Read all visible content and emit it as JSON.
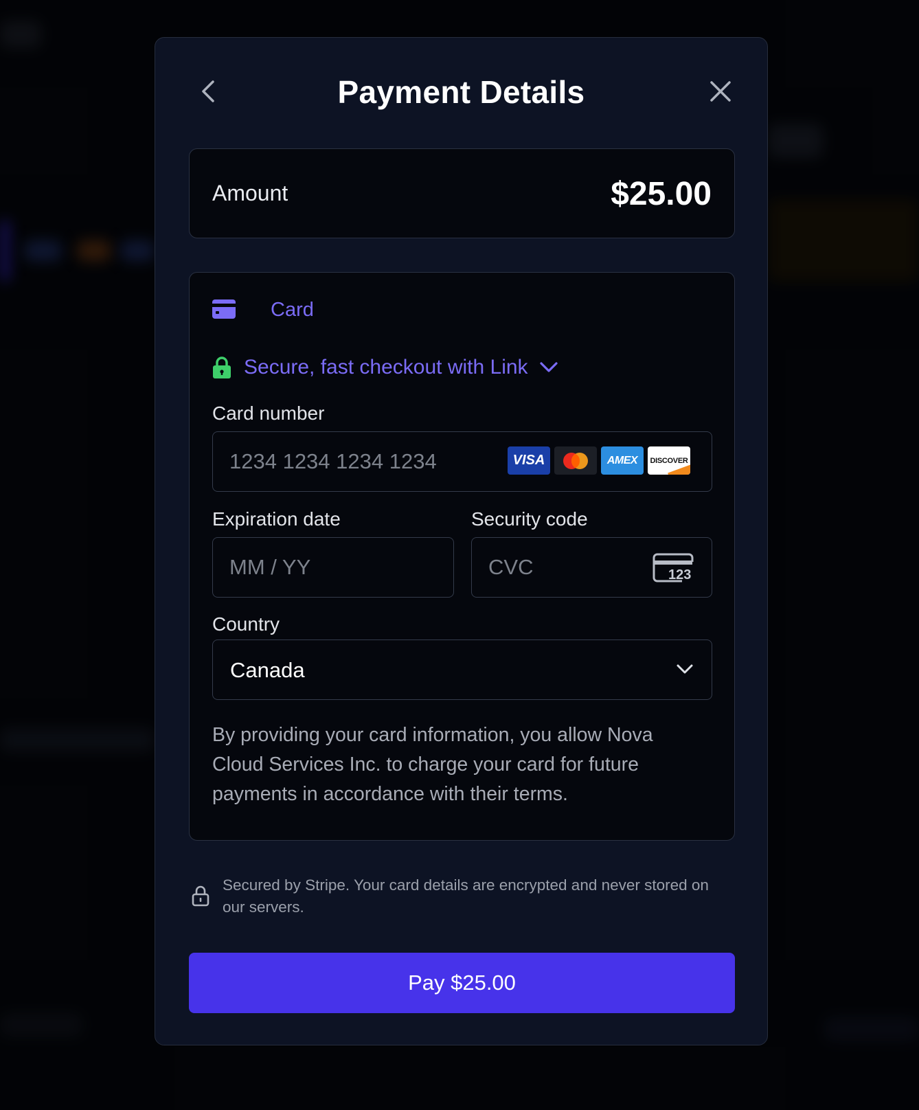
{
  "modal": {
    "title": "Payment Details",
    "back_icon": "chevron-left-icon",
    "close_icon": "close-icon"
  },
  "amount": {
    "label": "Amount",
    "value": "$25.00"
  },
  "payment_method": {
    "tab_label": "Card",
    "tab_icon": "credit-card-icon",
    "link_text": "Secure, fast checkout with Link",
    "link_icon": "lock-icon"
  },
  "card_number": {
    "label": "Card number",
    "placeholder": "1234 1234 1234 1234",
    "brands": [
      "VISA",
      "mastercard",
      "AMEX",
      "DISCOVER"
    ]
  },
  "expiration": {
    "label": "Expiration date",
    "placeholder": "MM / YY"
  },
  "security_code": {
    "label": "Security code",
    "placeholder": "CVC",
    "icon_text": "123"
  },
  "country": {
    "label": "Country",
    "value": "Canada"
  },
  "consent_text": "By providing your card information, you allow Nova Cloud Services Inc. to charge your card for future payments in accordance with their terms.",
  "secure_note": "Secured by Stripe. Your card details are encrypted and never stored on our servers.",
  "pay_button": "Pay $25.00",
  "colors": {
    "accent": "#4733ea",
    "link": "#7b6cf6",
    "lock_green": "#3ecf6a",
    "modal_bg": "#0d1324"
  }
}
